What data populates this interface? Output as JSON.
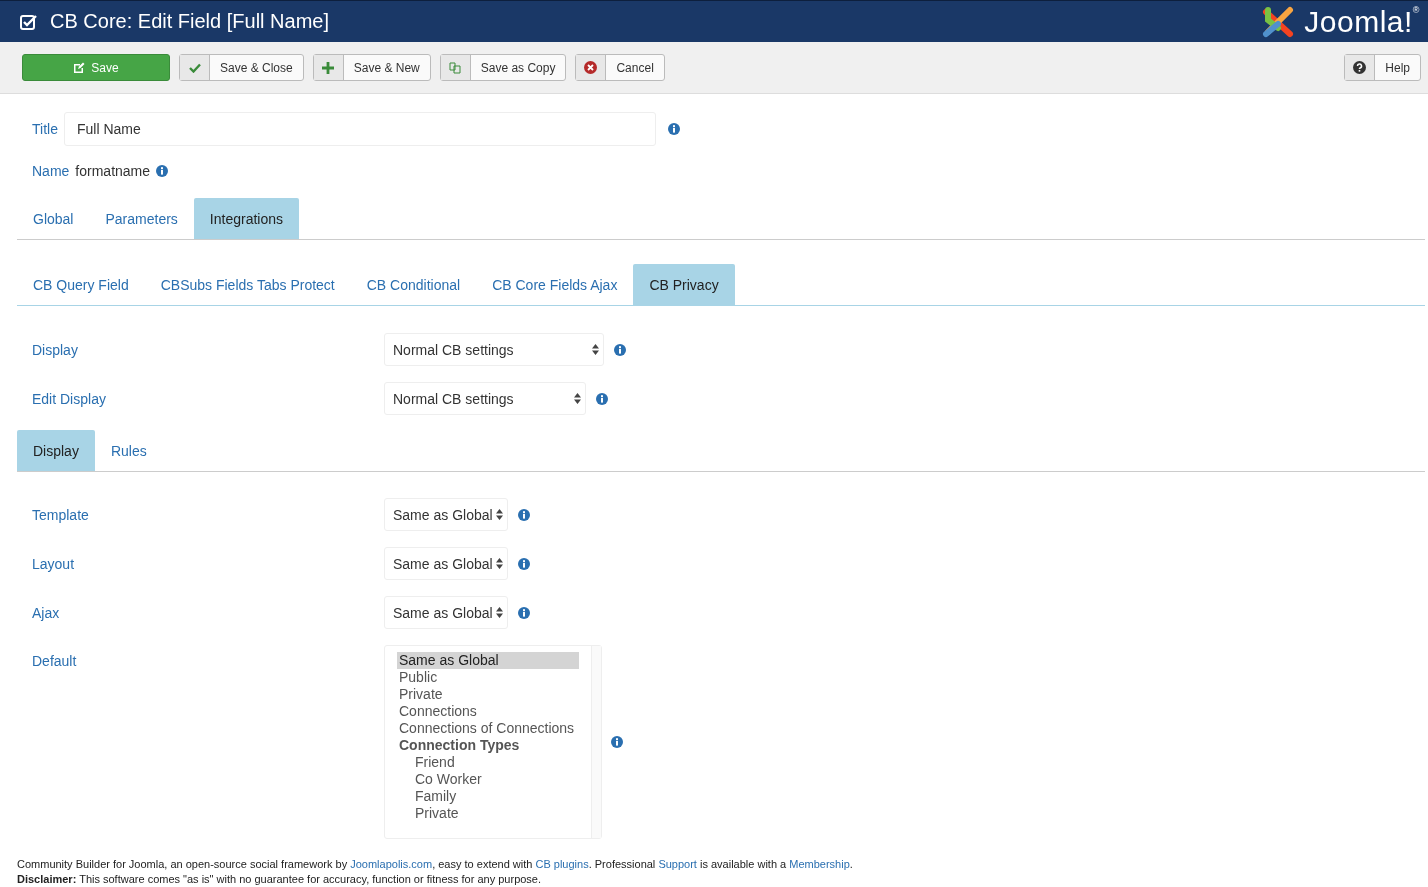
{
  "header": {
    "title": "CB Core: Edit Field [Full Name]",
    "logo_text": "Joomla!$^{®}$"
  },
  "toolbar": [
    {
      "label": "Save",
      "kind": "save"
    },
    {
      "label": "Save & Close",
      "kind": "close"
    },
    {
      "label": "Save & New",
      "kind": "new"
    },
    {
      "label": "Save as Copy",
      "kind": "copy"
    },
    {
      "label": "Cancel",
      "kind": "cancel"
    }
  ],
  "help_button": {
    "label": "Help"
  },
  "title_field": {
    "label": "Title",
    "value": "Full Name"
  },
  "name_field": {
    "label": "Name",
    "value": "formatname"
  },
  "main_tabs": [
    {
      "label": "Global",
      "selected": false
    },
    {
      "label": "Parameters",
      "selected": false
    },
    {
      "label": "Integrations",
      "selected": true
    }
  ],
  "integration_tabs": [
    {
      "label": "CB Query Field",
      "selected": false
    },
    {
      "label": "CBSubs Fields Tabs Protect",
      "selected": false
    },
    {
      "label": "CB Conditional",
      "selected": false
    },
    {
      "label": "CB Core Fields Ajax",
      "selected": false
    },
    {
      "label": "CB Privacy",
      "selected": true
    }
  ],
  "privacy_settings": [
    {
      "label": "Display",
      "value": "Normal CB settings"
    },
    {
      "label": "Edit Display",
      "value": "Normal CB settings"
    }
  ],
  "sub_tabs": [
    {
      "label": "Display",
      "selected": true
    },
    {
      "label": "Rules",
      "selected": false
    }
  ],
  "display_settings": [
    {
      "label": "Template",
      "value": "Same as Global"
    },
    {
      "label": "Layout",
      "value": "Same as Global"
    },
    {
      "label": "Ajax",
      "value": "Same as Global"
    }
  ],
  "default_setting": {
    "label": "Default",
    "options": [
      {
        "label": "Same as Global",
        "selected": true
      },
      {
        "label": "Public",
        "selected": false
      },
      {
        "label": "Private",
        "selected": false
      },
      {
        "label": "Connections",
        "selected": false
      },
      {
        "label": "Connections of Connections",
        "selected": false
      },
      {
        "label": "Connection Types",
        "kind": "group",
        "children": [
          {
            "label": "Friend",
            "selected": false
          },
          {
            "label": "Co Worker",
            "selected": false
          },
          {
            "label": "Family",
            "selected": false
          },
          {
            "label": "Private",
            "selected": false
          }
        ]
      }
    ]
  },
  "footer": {
    "credits": [
      {
        "kind": "text",
        "text": "Community Builder for Joomla, an open-source social framework by "
      },
      {
        "kind": "link",
        "text": "Joomlapolis.com"
      },
      {
        "kind": "text",
        "text": ", easy to extend with "
      },
      {
        "kind": "link",
        "text": "CB plugins"
      },
      {
        "kind": "text",
        "text": ". Professional "
      },
      {
        "kind": "link",
        "text": "Support"
      },
      {
        "kind": "text",
        "text": " is available with a "
      },
      {
        "kind": "link",
        "text": "Membership"
      },
      {
        "kind": "text",
        "text": "."
      }
    ],
    "disclaimer": "**Disclaimer:** This software comes \"as is\" with no guarantee for accuracy, function or fitness for any purpose."
  }
}
